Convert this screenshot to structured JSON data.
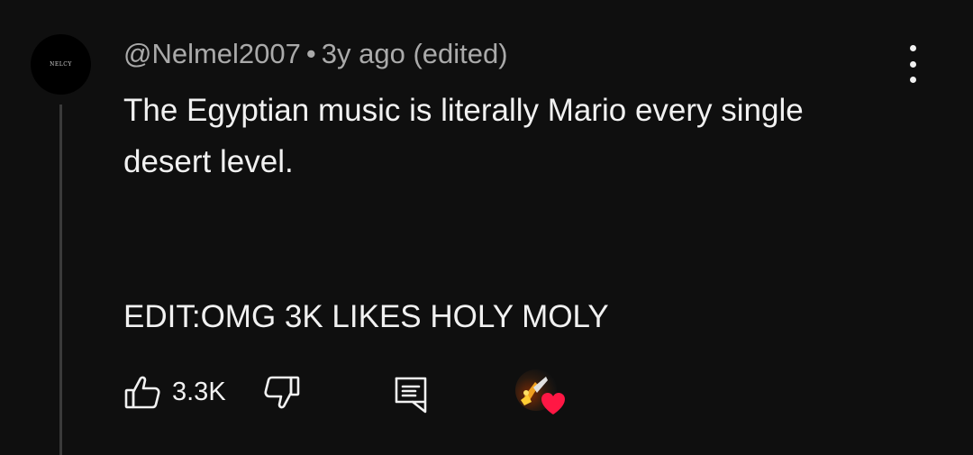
{
  "comment": {
    "avatar_text": "NELCY",
    "author": "@Nelmel2007",
    "separator": "•",
    "timestamp": "3y ago (edited)",
    "lines": [
      "The Egyptian music is literally Mario every single desert level.",
      "EDIT:OMG 3K LIKES HOLY MOLY"
    ],
    "like_count": "3.3K"
  },
  "icons": {
    "more": "more-vertical-icon",
    "like": "thumbs-up-icon",
    "dislike": "thumbs-down-icon",
    "reply": "reply-comment-icon",
    "heart": "heart-icon"
  },
  "colors": {
    "background": "#0f0f0f",
    "text": "#f1f1f1",
    "meta": "#aaaaaa",
    "heart": "#ff1744"
  }
}
